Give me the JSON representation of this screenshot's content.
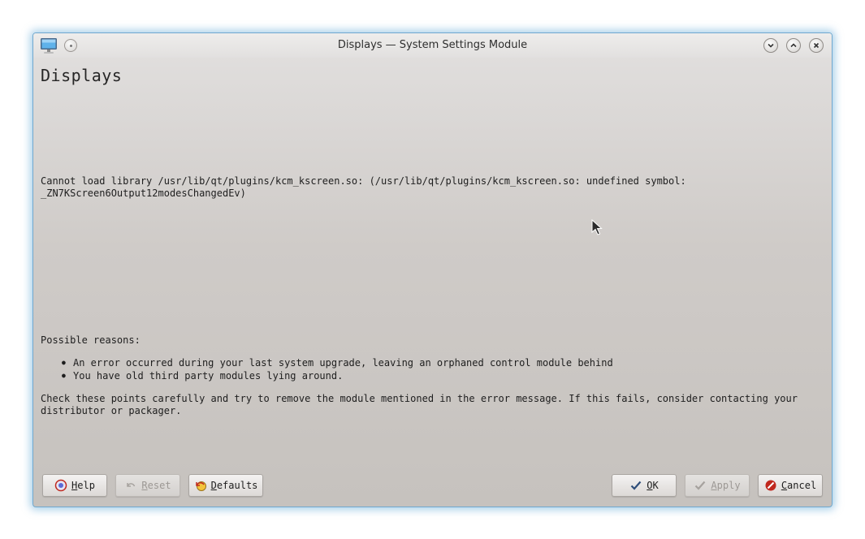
{
  "window": {
    "title": "Displays — System Settings Module"
  },
  "page": {
    "heading": "Displays",
    "error_message": "Cannot load library /usr/lib/qt/plugins/kcm_kscreen.so: (/usr/lib/qt/plugins/kcm_kscreen.so: undefined symbol: _ZN7KScreen6Output12modesChangedEv)",
    "reasons_title": "Possible reasons:",
    "reasons": [
      "An error occurred during your last system upgrade, leaving an orphaned control module behind",
      "You have old third party modules lying around."
    ],
    "advice": "Check these points carefully and try to remove the module mentioned in the error message. If this fails, consider contacting your distributor or packager."
  },
  "buttons": {
    "help": {
      "mnemonic": "H",
      "rest": "elp"
    },
    "reset": {
      "mnemonic": "R",
      "rest": "eset"
    },
    "defaults": {
      "mnemonic": "D",
      "rest": "efaults"
    },
    "ok": {
      "mnemonic": "O",
      "rest": "K"
    },
    "apply": {
      "mnemonic": "A",
      "rest": "pply"
    },
    "cancel": {
      "mnemonic": "C",
      "rest": "ancel"
    }
  },
  "icons": {
    "app": "monitor-icon",
    "pin": "pin-icon",
    "minimize": "chevron-down-icon",
    "maximize": "chevron-up-icon",
    "close": "close-icon",
    "help": "help-icon",
    "reset": "undo-icon",
    "defaults": "defaults-icon",
    "ok": "checkmark-icon",
    "apply": "checkmark-icon",
    "cancel": "cancel-icon"
  },
  "colors": {
    "window_border": "#6fa8cf",
    "cancel_red": "#c0281e"
  }
}
